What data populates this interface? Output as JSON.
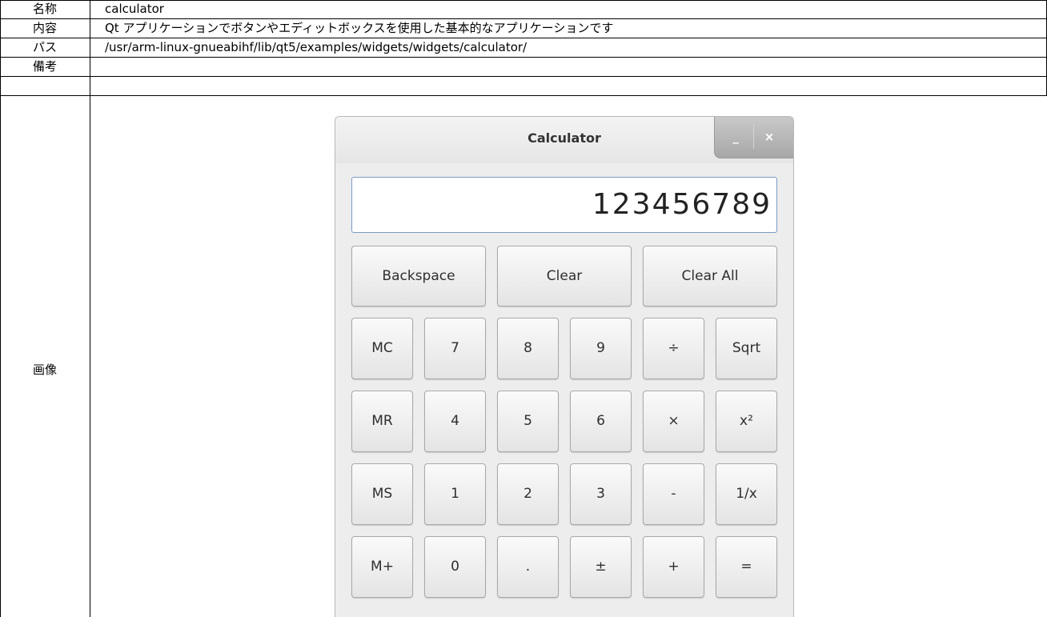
{
  "table": {
    "rows": [
      {
        "label": "名称",
        "value": "calculator"
      },
      {
        "label": "内容",
        "value": "Qt アプリケーションでボタンやエディットボックスを使用した基本的なアプリケーションです"
      },
      {
        "label": "パス",
        "value": "/usr/arm-linux-gnueabihf/lib/qt5/examples/widgets/widgets/calculator/"
      },
      {
        "label": "備考",
        "value": ""
      },
      {
        "label": "画像",
        "value": ""
      }
    ]
  },
  "window": {
    "title": "Calculator",
    "minimize_glyph": "_",
    "close_glyph": "×"
  },
  "display": {
    "value": "123456789"
  },
  "keys": {
    "top": [
      "Backspace",
      "Clear",
      "Clear All"
    ],
    "grid": [
      [
        "MC",
        "7",
        "8",
        "9",
        "÷",
        "Sqrt"
      ],
      [
        "MR",
        "4",
        "5",
        "6",
        "×",
        "x²"
      ],
      [
        "MS",
        "1",
        "2",
        "3",
        "-",
        "1/x"
      ],
      [
        "M+",
        "0",
        ".",
        "±",
        "+",
        "="
      ]
    ]
  }
}
